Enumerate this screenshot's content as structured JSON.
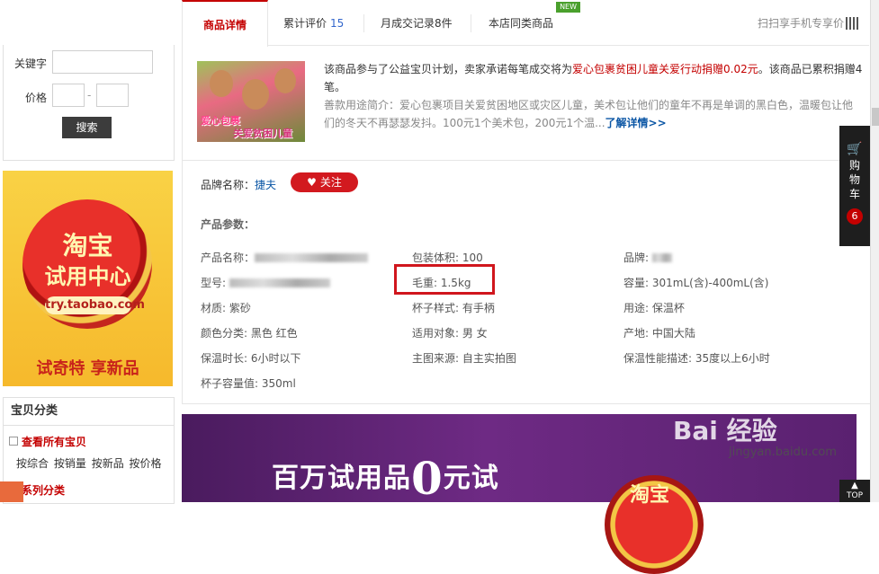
{
  "tabs": [
    {
      "label": "商品详情",
      "count": ""
    },
    {
      "label": "累计评价",
      "count": "15"
    },
    {
      "label": "月成交记录",
      "count": "8件"
    },
    {
      "label": "本店同类商品",
      "count": "",
      "badge": "NEW"
    }
  ],
  "scan_text": "扫扫享手机专享价",
  "sidebar": {
    "keyword_label": "关键字",
    "price_label": "价格",
    "price_sep": "-",
    "search_btn": "搜索",
    "promo": {
      "line1": "淘宝",
      "line2": "试用中心",
      "url": "try.taobao.com",
      "slogan": "试奇特 享新品"
    },
    "category_title": "宝贝分类",
    "view_all": "查看所有宝贝",
    "sort_links": [
      "按综合",
      "按销量",
      "按新品",
      "按价格"
    ],
    "series": "系列分类"
  },
  "charity": {
    "image_caption1": "爱心包裹",
    "image_caption2": "关爱贫困儿童",
    "text_pre": "该商品参与了公益宝贝计划，卖家承诺每笔成交将为",
    "text_red": "爱心包裹贫困儿童关爱行动捐赠0.02元",
    "text_post": "。该商品已累积捐赠4笔。",
    "desc": "善款用途简介：爱心包裹项目关爱贫困地区或灾区儿童，美术包让他们的童年不再是单调的黑白色，温暖包让他们的冬天不再瑟瑟发抖。100元1个美术包，200元1个温...",
    "more": "了解详情>>"
  },
  "brand": {
    "label": "品牌名称：",
    "name": "捷夫",
    "follow": "关注"
  },
  "params_title": "产品参数：",
  "params": [
    [
      "产品名称：",
      "包装体积: 100",
      "品牌:"
    ],
    [
      "型号:",
      "毛重: 1.5kg",
      "容量: 301mL(含)-400mL(含)"
    ],
    [
      "材质: 紫砂",
      "杯子样式: 有手柄",
      "用途: 保温杯"
    ],
    [
      "颜色分类: 黑色 红色",
      "适用对象: 男 女",
      "产地: 中国大陆"
    ],
    [
      "保温时长: 6小时以下",
      "主图来源: 自主实拍图",
      "保温性能描述: 35度以上6小时"
    ],
    [
      "杯子容量值: 350ml",
      "",
      ""
    ]
  ],
  "banner": {
    "text": "百万试用品",
    "zero": "0",
    "tail": "元试",
    "seal": "淘宝"
  },
  "cart": {
    "label": "购物车",
    "count": "6"
  },
  "top_label": "TOP",
  "watermark": {
    "main": "Bai 经验",
    "site": "jingyan.baidu.com",
    "brand": "淘宝试用",
    "brand_url": "try.taobao.com"
  },
  "colors": {
    "accent": "#c40000",
    "link": "#0b56a5",
    "highlight_box": "#d0161d"
  }
}
